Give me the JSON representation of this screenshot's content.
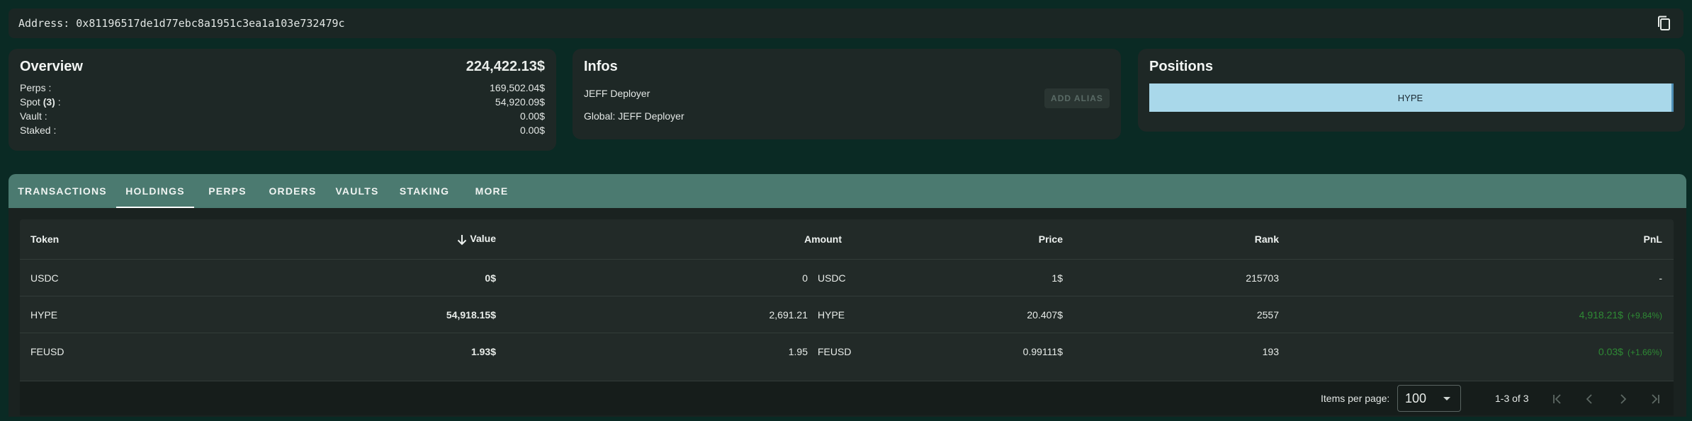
{
  "address": {
    "label": "Address:",
    "value": "0x81196517de1d77ebc8a1951c3ea1a103e732479c",
    "copy_icon": "copy-icon"
  },
  "overview": {
    "title": "Overview",
    "total": "224,422.13$",
    "rows": [
      {
        "label": "Perps :",
        "value": "169,502.04$"
      },
      {
        "label_pre": "Spot ",
        "label_count": "(3)",
        "label_post": " :",
        "value": "54,920.09$"
      },
      {
        "label": "Vault :",
        "value": "0.00$"
      },
      {
        "label": "Staked :",
        "value": "0.00$"
      }
    ]
  },
  "infos": {
    "title": "Infos",
    "deployer": "JEFF Deployer",
    "global": "Global: JEFF Deployer",
    "alias_button": "ADD ALIAS"
  },
  "positions": {
    "title": "Positions",
    "bar_label": "HYPE"
  },
  "tabs": [
    {
      "label": "TRANSACTIONS",
      "active": false
    },
    {
      "label": "HOLDINGS",
      "active": true
    },
    {
      "label": "PERPS",
      "active": false
    },
    {
      "label": "ORDERS",
      "active": false
    },
    {
      "label": "VAULTS",
      "active": false
    },
    {
      "label": "STAKING",
      "active": false
    },
    {
      "label": "MORE",
      "active": false
    }
  ],
  "table": {
    "headers": {
      "token": "Token",
      "value": "Value",
      "amount": "Amount",
      "price": "Price",
      "rank": "Rank",
      "pnl": "PnL"
    },
    "rows": [
      {
        "token": "USDC",
        "value": "0$",
        "amount": "0",
        "symbol": "USDC",
        "price": "1$",
        "rank": "215703",
        "pnl": "-",
        "pnl_pct": ""
      },
      {
        "token": "HYPE",
        "value": "54,918.15$",
        "amount": "2,691.21",
        "symbol": "HYPE",
        "price": "20.407$",
        "rank": "2557",
        "pnl": "4,918.21$",
        "pnl_pct": "(+9.84%)"
      },
      {
        "token": "FEUSD",
        "value": "1.93$",
        "amount": "1.95",
        "symbol": "FEUSD",
        "price": "0.99111$",
        "rank": "193",
        "pnl": "0.03$",
        "pnl_pct": "(+1.66%)"
      }
    ]
  },
  "pagination": {
    "items_per_page_label": "Items per page:",
    "items_per_page": "100",
    "range": "1-3 of 3"
  },
  "colors": {
    "background": "#0a2a24",
    "card": "#1e2826",
    "tabs_bar": "#4b7a70",
    "pnl_positive": "#2e8a34",
    "position_bar": "#a9d8ea"
  }
}
